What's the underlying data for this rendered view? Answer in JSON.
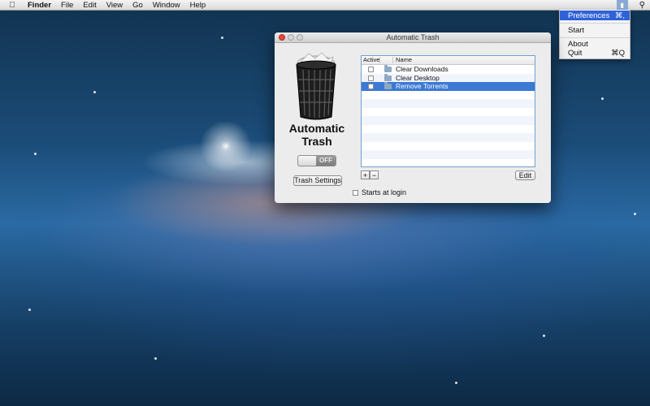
{
  "menubar": {
    "app_name": "Finder",
    "items": [
      "File",
      "Edit",
      "View",
      "Go",
      "Window",
      "Help"
    ],
    "icons": [
      "apple-icon",
      "trash-tray-icon",
      "spotlight-icon"
    ]
  },
  "status_menu": {
    "items": [
      {
        "label": "Preferences",
        "shortcut": "⌘,",
        "highlighted": true
      },
      {
        "label": "Start",
        "shortcut": ""
      },
      {
        "label": "About",
        "shortcut": ""
      },
      {
        "label": "Quit",
        "shortcut": "⌘Q"
      }
    ]
  },
  "window": {
    "title": "Automatic Trash",
    "app_title_line1": "Automatic",
    "app_title_line2": "Trash",
    "switch_label": "OFF",
    "trash_settings_button": "Trash Settings",
    "table": {
      "columns": [
        "Active",
        "Name"
      ],
      "rows": [
        {
          "active": false,
          "name": "Clear Downloads"
        },
        {
          "active": false,
          "name": "Clear Desktop"
        },
        {
          "active": false,
          "name": "Remove Torrents",
          "selected": true
        }
      ]
    },
    "add_button": "+",
    "remove_button": "−",
    "edit_button": "Edit",
    "starts_at_login": "Starts at login"
  },
  "colors": {
    "selection": "#3b79d4",
    "menu_highlight": "#2f62d8",
    "close_button": "#e2463f"
  }
}
